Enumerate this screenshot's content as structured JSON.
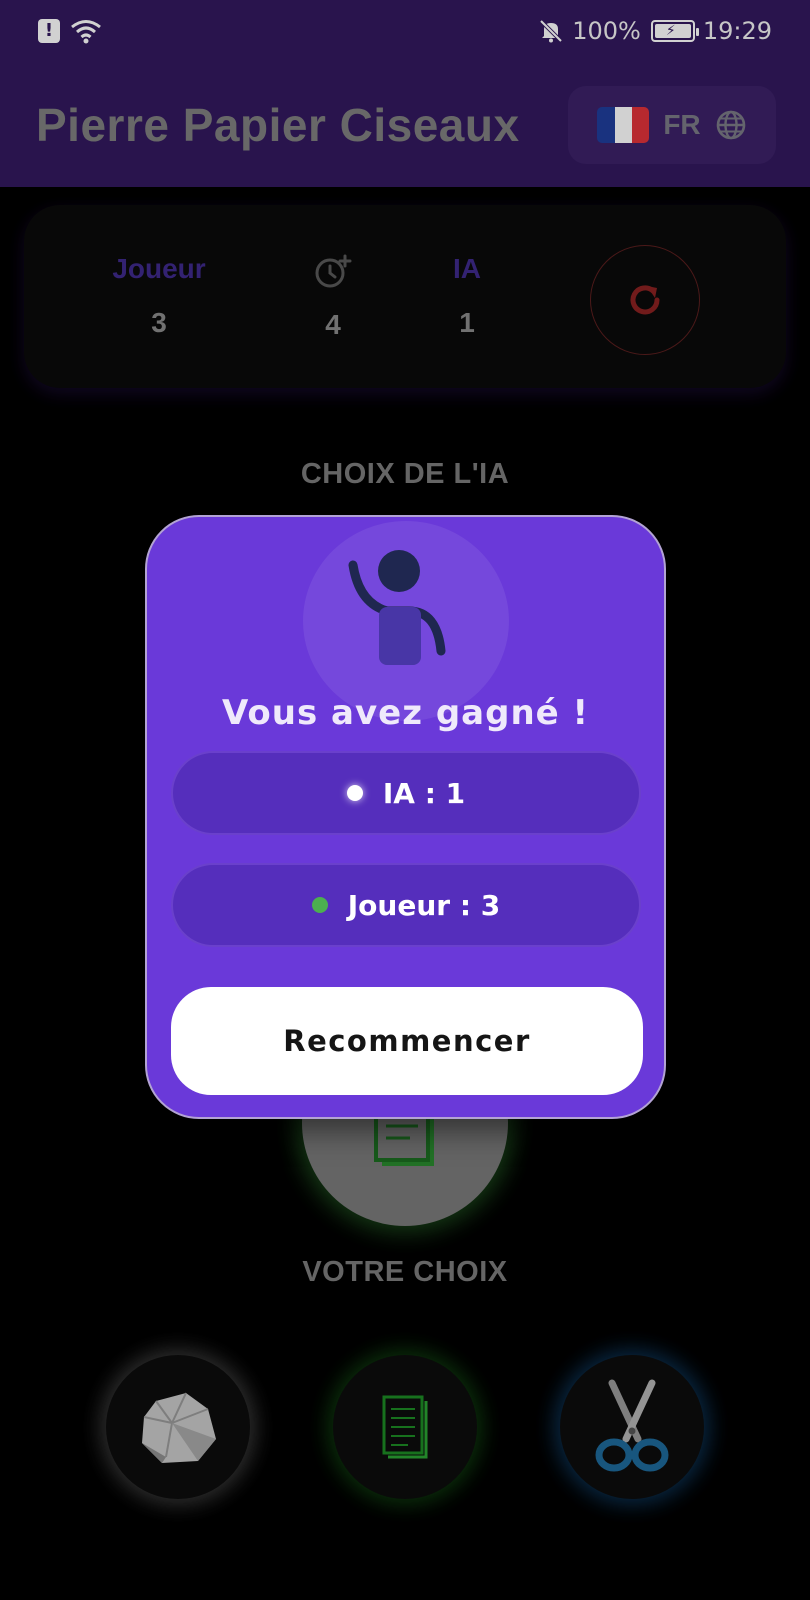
{
  "status_bar": {
    "battery": "100%",
    "time": "19:29",
    "icons": [
      "alert-icon",
      "wifi-icon",
      "notifications-off-icon",
      "battery-charging-icon"
    ]
  },
  "app_bar": {
    "title": "Pierre Papier Ciseaux",
    "language_code": "FR",
    "flag": "france-flag",
    "icons": [
      "globe-icon"
    ]
  },
  "scoreboard": {
    "player_label": "Joueur",
    "player_score": "3",
    "rounds_value": "4",
    "ai_label": "IA",
    "ai_score": "1",
    "icons": [
      "timer-plus-icon",
      "refresh-icon"
    ]
  },
  "sections": {
    "ai_choice_label": "CHOIX DE L'IA",
    "your_choice_label": "VOTRE CHOIX"
  },
  "choices": [
    {
      "name": "rock",
      "icon": "rock-icon"
    },
    {
      "name": "paper",
      "icon": "paper-icon"
    },
    {
      "name": "scissors",
      "icon": "scissors-icon"
    }
  ],
  "modal": {
    "title": "Vous avez gagné !",
    "ai_score_text": "IA : 1",
    "player_score_text": "Joueur : 3",
    "restart_label": "Recommencer",
    "icons": [
      "waving-person-icon"
    ]
  },
  "colors": {
    "header_bg": "#33195f",
    "modal_bg": "#6a39d9",
    "pill_bg": "#552ebc",
    "player_dot": "#4caf50",
    "ai_dot": "#ffffff",
    "reset_red": "#8a2222"
  }
}
